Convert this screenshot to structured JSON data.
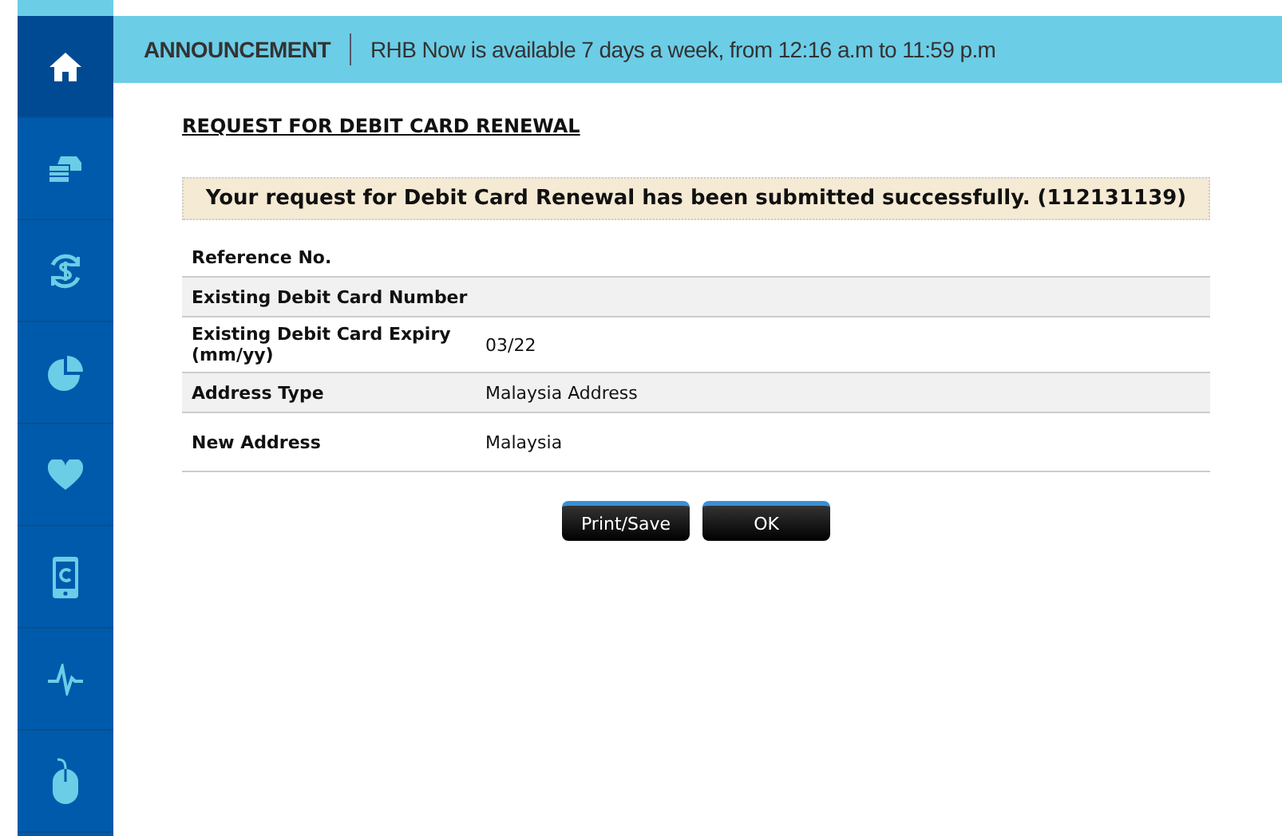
{
  "sidebar": {
    "items": [
      {
        "kind": "home",
        "selected": true
      },
      {
        "kind": "card",
        "selected": false
      },
      {
        "kind": "dollar",
        "selected": false
      },
      {
        "kind": "pie",
        "selected": false
      },
      {
        "kind": "heart",
        "selected": false
      },
      {
        "kind": "phone",
        "selected": false
      },
      {
        "kind": "pulse",
        "selected": false
      },
      {
        "kind": "mouse",
        "selected": false
      }
    ]
  },
  "announcement": {
    "label": "ANNOUNCEMENT",
    "text": "RHB Now is available 7 days a week, from 12:16 a.m to 11:59 p.m"
  },
  "page_title": "REQUEST FOR DEBIT CARD RENEWAL",
  "success_message": "Your request for Debit Card Renewal has been submitted successfully. (112131139)",
  "details": [
    {
      "label": "Reference No."
    },
    {
      "label": "Existing Debit Card Number"
    },
    {
      "label": "Existing Debit Card Expiry (mm/yy)",
      "value": "03/22"
    },
    {
      "label": "Address Type",
      "value": "Malaysia Address"
    },
    {
      "label": "New Address",
      "value": "Malaysia"
    }
  ],
  "buttons": [
    "Print/Save",
    "OK"
  ]
}
